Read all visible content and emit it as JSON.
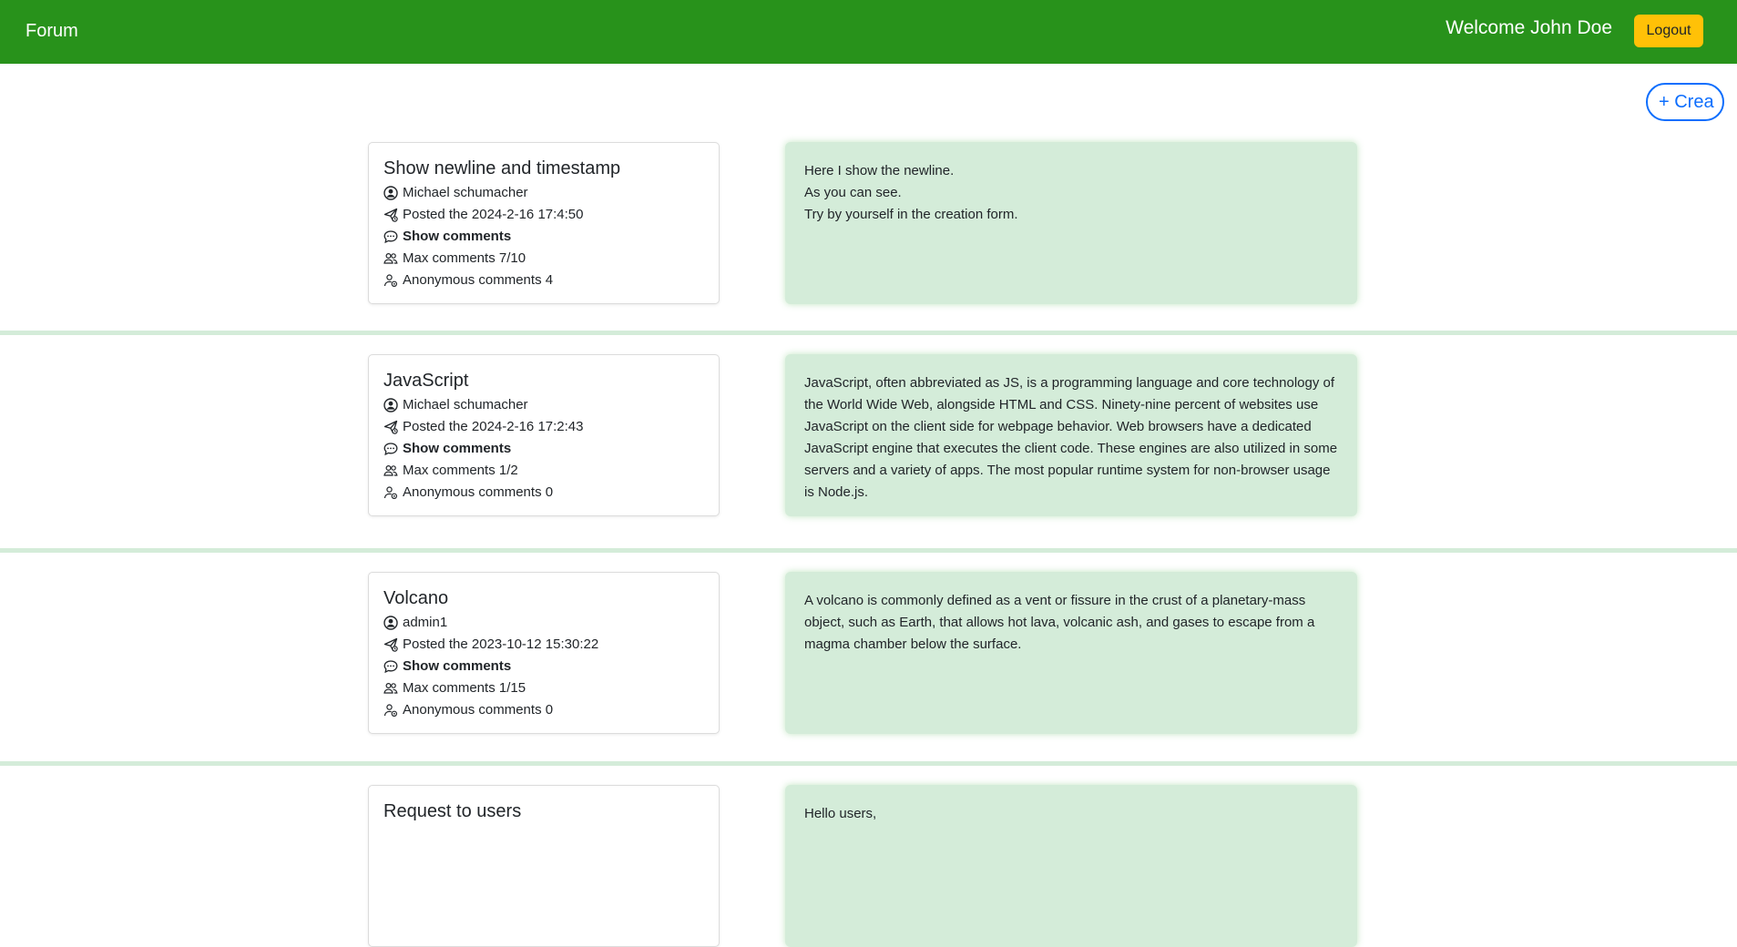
{
  "nav": {
    "brand": "Forum",
    "welcome": "Welcome John Doe",
    "logout": "Logout"
  },
  "create_button": "+ Crea",
  "posts": [
    {
      "title": "Show newline and timestamp",
      "author": "Michael schumacher",
      "posted": "Posted the 2024-2-16 17:4:50",
      "show_comments": "Show comments",
      "max_comments": "Max comments 7/10",
      "anonymous": "Anonymous comments 4",
      "body": "Here I show the newline.\nAs you can see.\nTry by yourself in the creation form."
    },
    {
      "title": "JavaScript",
      "author": "Michael schumacher",
      "posted": "Posted the 2024-2-16 17:2:43",
      "show_comments": "Show comments",
      "max_comments": "Max comments 1/2",
      "anonymous": "Anonymous comments 0",
      "body": "JavaScript, often abbreviated as JS, is a programming language and core technology of the World Wide Web, alongside HTML and CSS. Ninety-nine percent of websites use JavaScript on the client side for webpage behavior. Web browsers have a dedicated JavaScript engine that executes the client code. These engines are also utilized in some servers and a variety of apps. The most popular runtime system for non-browser usage is Node.js."
    },
    {
      "title": "Volcano",
      "author": "admin1",
      "posted": "Posted the 2023-10-12 15:30:22",
      "show_comments": "Show comments",
      "max_comments": "Max comments 1/15",
      "anonymous": "Anonymous comments 0",
      "body": "A volcano is commonly defined as a vent or fissure in the crust of a planetary-mass object, such as Earth, that allows hot lava, volcanic ash, and gases to escape from a magma chamber below the surface."
    },
    {
      "title": "Request to users",
      "body": "Hello users,"
    }
  ],
  "colors": {
    "navbar": "#28921b",
    "logout": "#ffc107",
    "create": "#0d6efd",
    "post_body": "#d4ecd9"
  },
  "icons": [
    "person-circle-icon",
    "send-icon",
    "chat-icon",
    "people-icon",
    "person-gear-icon"
  ]
}
